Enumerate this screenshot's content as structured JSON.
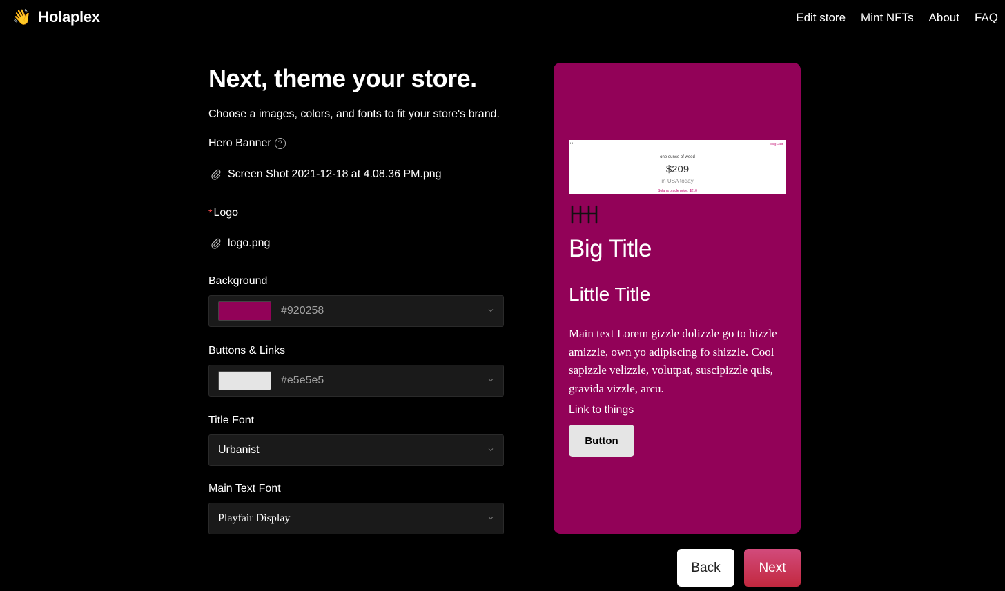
{
  "header": {
    "brand_emoji": "👋",
    "brand_name": "Holaplex",
    "nav": [
      "Edit store",
      "Mint NFTs",
      "About",
      "FAQ"
    ]
  },
  "form": {
    "title": "Next, theme your store.",
    "subtitle": "Choose a images, colors, and fonts to fit your store's brand.",
    "hero_banner_label": "Hero Banner",
    "hero_banner_help": "?",
    "hero_banner_file": "Screen Shot 2021-12-18 at 4.08.36 PM.png",
    "logo_required_mark": "*",
    "logo_label": "Logo",
    "logo_file": "logo.png",
    "background_label": "Background",
    "background_value": "#920258",
    "buttons_label": "Buttons & Links",
    "buttons_value": "#e5e5e5",
    "title_font_label": "Title Font",
    "title_font_value": "Urbanist",
    "main_font_label": "Main Text Font",
    "main_font_value": "Playfair Display"
  },
  "preview": {
    "banner_logo": "HH",
    "banner_nav": "Blog  Code",
    "banner_line1": "one ounce of weed",
    "banner_price": "$209",
    "banner_line3": "in USA today",
    "banner_line4": "Solana oracle price: $210",
    "big_title": "Big Title",
    "little_title": "Little Title",
    "main_text": "Main text Lorem gizzle dolizzle go to hizzle amizzle, own yo adipiscing fo shizzle. Cool sapizzle velizzle, volutpat, suscipizzle quis, gravida vizzle, arcu.",
    "link_text": "Link to things",
    "button_text": "Button"
  },
  "footer": {
    "back_label": "Back",
    "next_label": "Next"
  },
  "colors": {
    "background": "#920258",
    "buttons": "#e5e5e5",
    "next_gradient_top": "#d24b7c",
    "next_gradient_bottom": "#c2283e"
  }
}
